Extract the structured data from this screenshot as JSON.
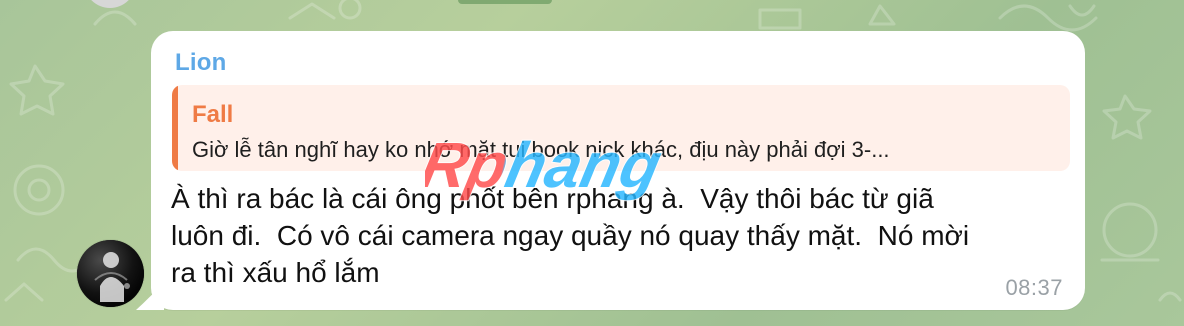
{
  "message": {
    "sender_name": "Lion",
    "reply_to": {
      "name": "Fall",
      "text": "Giờ lễ tân nghĩ hay ko nhớ mặt tui book nick khác, địu này phải đợi 3-..."
    },
    "text": "À thì ra bác là cái ông phốt bên rphang à.  Vậy thôi bác từ giã\nluôn đi.  Có vô cái camera ngay quầy nó quay thấy mặt.  Nó mời\nra thì xấu hổ lắm",
    "time": "08:37"
  },
  "watermark": {
    "text": "Rphang"
  },
  "colors": {
    "sender_name": "#5ea8e6",
    "reply_accent": "#ef7b45",
    "reply_background": "#fff0ea",
    "bubble_background": "#ffffff",
    "time_text": "#9aa1a6",
    "chat_background": "#aac69b",
    "watermark_primary": "#ff4b4b",
    "watermark_secondary": "#27b6ff"
  },
  "icons": {
    "avatar": "user-avatar-dark-portrait",
    "background_pattern": "chat-doodle-pattern"
  }
}
